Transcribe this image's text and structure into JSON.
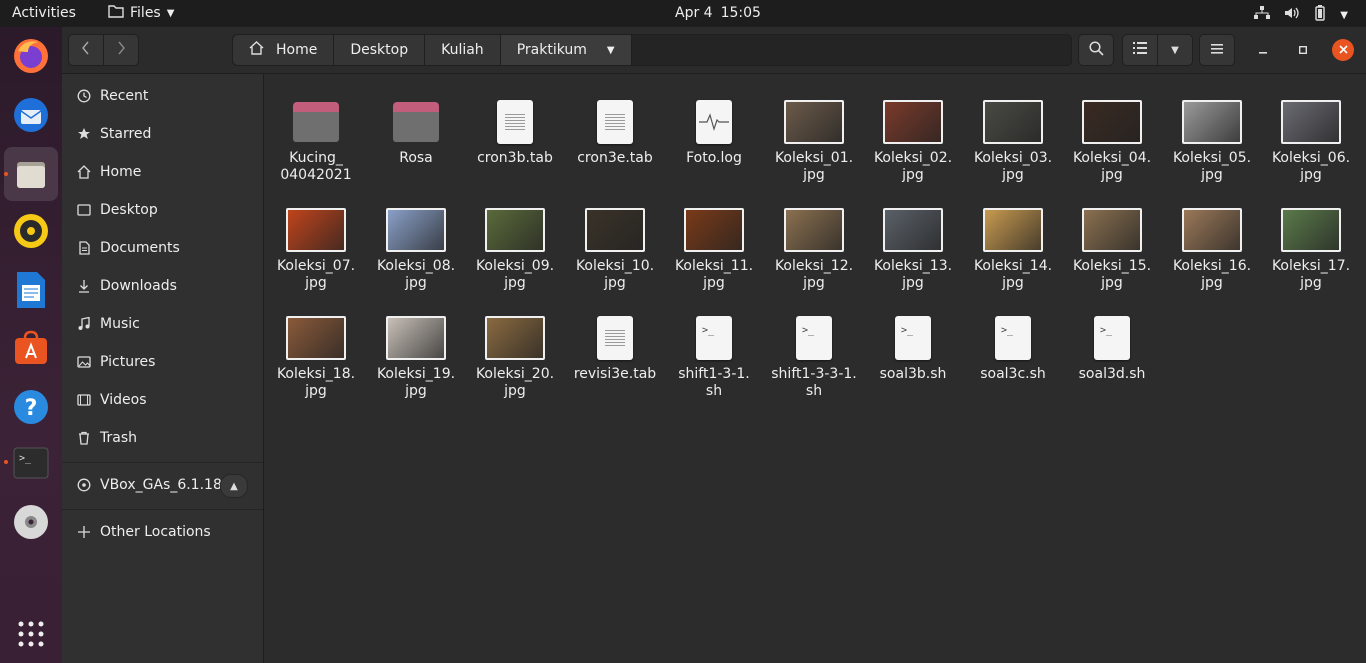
{
  "topbar": {
    "activities": "Activities",
    "app_menu": "Files",
    "date": "Apr 4",
    "time": "15:05"
  },
  "dock": {
    "items": [
      "firefox-icon",
      "thunderbird-icon",
      "files-icon",
      "rhythmbox-icon",
      "writer-icon",
      "software-icon",
      "help-icon",
      "terminal-icon",
      "disc-icon",
      "app-grid-icon"
    ]
  },
  "pathbar": {
    "crumbs": [
      "Home",
      "Desktop",
      "Kuliah",
      "Praktikum"
    ]
  },
  "sidebar": {
    "items": [
      {
        "label": "Recent",
        "icon": "clock-icon"
      },
      {
        "label": "Starred",
        "icon": "star-icon"
      },
      {
        "label": "Home",
        "icon": "home-icon"
      },
      {
        "label": "Desktop",
        "icon": "desktop-icon"
      },
      {
        "label": "Documents",
        "icon": "documents-icon"
      },
      {
        "label": "Downloads",
        "icon": "downloads-icon"
      },
      {
        "label": "Music",
        "icon": "music-icon"
      },
      {
        "label": "Pictures",
        "icon": "pictures-icon"
      },
      {
        "label": "Videos",
        "icon": "videos-icon"
      },
      {
        "label": "Trash",
        "icon": "trash-icon"
      }
    ],
    "device": "VBox_GAs_6.1.18",
    "other": "Other Locations"
  },
  "files": [
    {
      "l1": "Kucing_",
      "l2": "04042021",
      "type": "folder"
    },
    {
      "l1": "Rosa",
      "l2": "",
      "type": "folder"
    },
    {
      "l1": "cron3b.tab",
      "l2": "",
      "type": "doc"
    },
    {
      "l1": "cron3e.tab",
      "l2": "",
      "type": "doc"
    },
    {
      "l1": "Foto.log",
      "l2": "",
      "type": "log"
    },
    {
      "l1": "Koleksi_01.",
      "l2": "jpg",
      "type": "img",
      "color": "#6b5a4a"
    },
    {
      "l1": "Koleksi_02.",
      "l2": "jpg",
      "type": "img",
      "color": "#7a3a2a"
    },
    {
      "l1": "Koleksi_03.",
      "l2": "jpg",
      "type": "img",
      "color": "#4a4a44"
    },
    {
      "l1": "Koleksi_04.",
      "l2": "jpg",
      "type": "img",
      "color": "#3a2a22"
    },
    {
      "l1": "Koleksi_05.",
      "l2": "jpg",
      "type": "img",
      "color": "#9a9a9a"
    },
    {
      "l1": "Koleksi_06.",
      "l2": "jpg",
      "type": "img",
      "color": "#6a6a72"
    },
    {
      "l1": "Koleksi_07.",
      "l2": "jpg",
      "type": "img",
      "color": "#c0441c"
    },
    {
      "l1": "Koleksi_08.",
      "l2": "jpg",
      "type": "img",
      "color": "#8aa0c8"
    },
    {
      "l1": "Koleksi_09.",
      "l2": "jpg",
      "type": "img",
      "color": "#5a6a3a"
    },
    {
      "l1": "Koleksi_10.",
      "l2": "jpg",
      "type": "img",
      "color": "#3a3228"
    },
    {
      "l1": "Koleksi_11.",
      "l2": "jpg",
      "type": "img",
      "color": "#7a3a18"
    },
    {
      "l1": "Koleksi_12.",
      "l2": "jpg",
      "type": "img",
      "color": "#8a7050"
    },
    {
      "l1": "Koleksi_13.",
      "l2": "jpg",
      "type": "img",
      "color": "#5a6068"
    },
    {
      "l1": "Koleksi_14.",
      "l2": "jpg",
      "type": "img",
      "color": "#c89a50"
    },
    {
      "l1": "Koleksi_15.",
      "l2": "jpg",
      "type": "img",
      "color": "#8a7050"
    },
    {
      "l1": "Koleksi_16.",
      "l2": "jpg",
      "type": "img",
      "color": "#9a7858"
    },
    {
      "l1": "Koleksi_17.",
      "l2": "jpg",
      "type": "img",
      "color": "#5a7a4a"
    },
    {
      "l1": "Koleksi_18.",
      "l2": "jpg",
      "type": "img",
      "color": "#8a5a3a"
    },
    {
      "l1": "Koleksi_19.",
      "l2": "jpg",
      "type": "img",
      "color": "#c8c0b8"
    },
    {
      "l1": "Koleksi_20.",
      "l2": "jpg",
      "type": "img",
      "color": "#8a6a40"
    },
    {
      "l1": "revisi3e.tab",
      "l2": "",
      "type": "doc"
    },
    {
      "l1": "shift1-3-1.",
      "l2": "sh",
      "type": "script"
    },
    {
      "l1": "shift1-3-3-1.",
      "l2": "sh",
      "type": "script"
    },
    {
      "l1": "soal3b.sh",
      "l2": "",
      "type": "script"
    },
    {
      "l1": "soal3c.sh",
      "l2": "",
      "type": "script"
    },
    {
      "l1": "soal3d.sh",
      "l2": "",
      "type": "script"
    }
  ],
  "colors": {
    "accent": "#e95420",
    "close": "#e95420",
    "folder_tab": "#c25e7c"
  }
}
